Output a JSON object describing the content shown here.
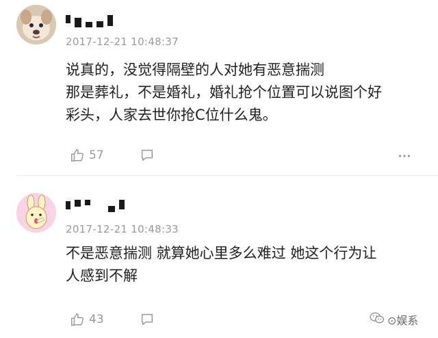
{
  "comments": [
    {
      "timestamp": "2017-12-21 10:48:37",
      "lines": [
        "说真的，没觉得隔壁的人对她有恶意揣测",
        "那是葬礼，不是婚礼，婚礼抢个位置可以说图个好",
        "彩头，人家去世你抢C位什么鬼。"
      ],
      "likes": "57"
    },
    {
      "timestamp": "2017-12-21 10:48:33",
      "lines": [
        "不是恶意揣测 就算她心里多么难过 她这个行为让",
        "人感到不解"
      ],
      "likes": "43"
    }
  ],
  "watermark": {
    "text": "⊙娱系"
  },
  "icons": {
    "like": "thumbs-up-icon",
    "reply": "comment-bubble-icon",
    "more": "more-dots-icon",
    "watermark": "wechat-logo-icon"
  },
  "colors": {
    "meta_gray": "#9a9a9a",
    "text": "#202020",
    "username_pixels": "#1a1a1a"
  }
}
